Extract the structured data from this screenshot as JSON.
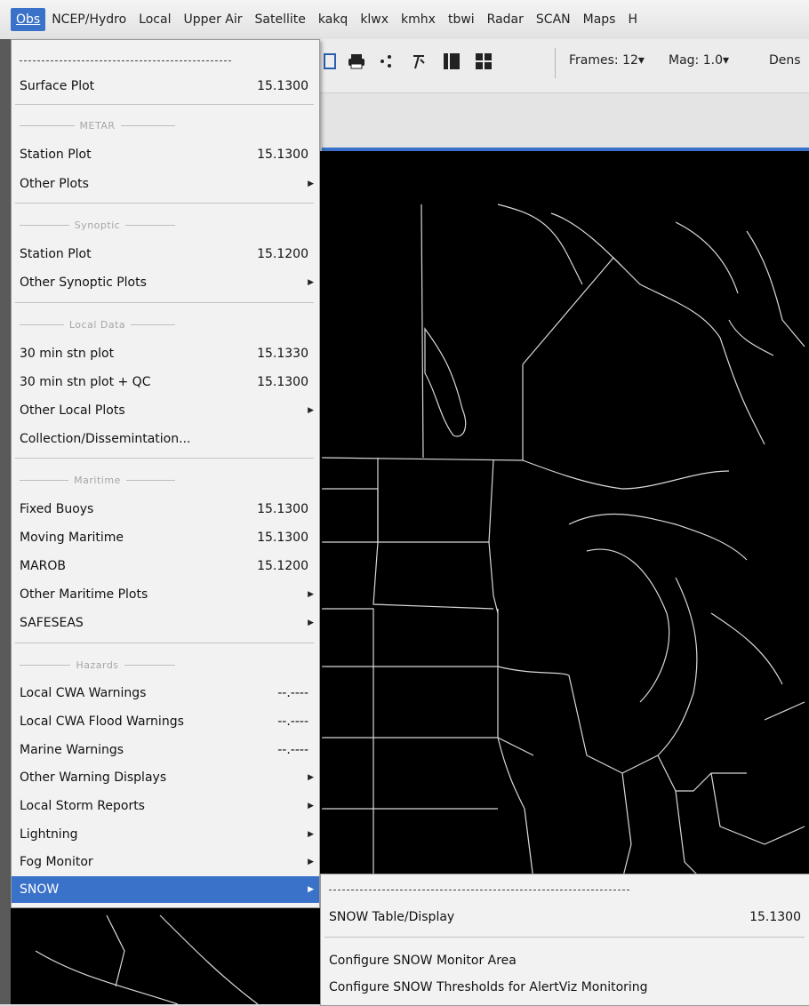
{
  "menubar": {
    "items": [
      "Obs",
      "NCEP/Hydro",
      "Local",
      "Upper Air",
      "Satellite",
      "kakq",
      "klwx",
      "kmhx",
      "tbwi",
      "Radar",
      "SCAN",
      "Maps",
      "H"
    ]
  },
  "toolbar": {
    "frames_label": "Frames: 12▾",
    "mag_label": "Mag: 1.0▾",
    "density_label": "Dens"
  },
  "obs_menu": {
    "surface_plot": {
      "label": "Surface Plot",
      "value": "15.1300"
    },
    "metar_header": "METAR",
    "metar_station": {
      "label": "Station Plot",
      "value": "15.1300"
    },
    "metar_other": {
      "label": "Other Plots"
    },
    "synoptic_header": "Synoptic",
    "syn_station": {
      "label": "Station Plot",
      "value": "15.1200"
    },
    "syn_other": {
      "label": "Other Synoptic Plots"
    },
    "local_header": "Local Data",
    "local_30": {
      "label": "30 min stn plot",
      "value": "15.1330"
    },
    "local_30qc": {
      "label": "30 min stn plot + QC",
      "value": "15.1300"
    },
    "local_other": {
      "label": "Other Local Plots"
    },
    "collection": {
      "label": "Collection/Dissemintation..."
    },
    "maritime_header": "Maritime",
    "fixed_buoys": {
      "label": "Fixed Buoys",
      "value": "15.1300"
    },
    "moving_maritime": {
      "label": "Moving Maritime",
      "value": "15.1300"
    },
    "marob": {
      "label": "MAROB",
      "value": "15.1200"
    },
    "other_maritime": {
      "label": "Other Maritime Plots"
    },
    "safeseas": {
      "label": "SAFESEAS"
    },
    "hazards_header": "Hazards",
    "cwa_warnings": {
      "label": "Local CWA Warnings",
      "value": "--.----"
    },
    "cwa_flood": {
      "label": "Local CWA Flood Warnings",
      "value": "--.----"
    },
    "marine_warnings": {
      "label": "Marine Warnings",
      "value": "--.----"
    },
    "other_warning": {
      "label": "Other Warning Displays"
    },
    "storm_reports": {
      "label": "Local Storm Reports"
    },
    "lightning": {
      "label": "Lightning"
    },
    "fog_monitor": {
      "label": "Fog Monitor"
    },
    "snow": {
      "label": "SNOW"
    }
  },
  "snow_submenu": {
    "table": {
      "label": "SNOW Table/Display",
      "value": "15.1300"
    },
    "config_area": {
      "label": "Configure SNOW Monitor Area"
    },
    "config_thresholds": {
      "label": "Configure SNOW Thresholds for AlertViz Monitoring"
    }
  },
  "colors": {
    "accent": "#3b72c9",
    "map_bg": "#000000",
    "map_lines": "#d8d8d8"
  }
}
